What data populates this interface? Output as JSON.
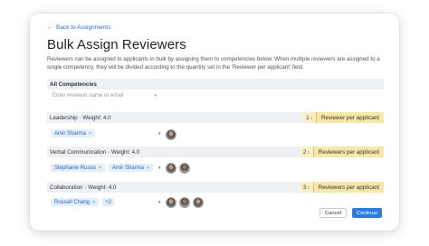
{
  "back_link": "Back to Assignments",
  "title": "Bulk Assign Reviewers",
  "description": "Reviewers can be assigned to applicants in bulk by assigning them to competencies below. When multiple reviewers are assigned to a single competency, they will be divided according to the quantity set in the 'Reviewer per applicant' field.",
  "all_competencies": {
    "label": "All Competencies",
    "placeholder": "Enter reviewer name or email"
  },
  "competencies": [
    {
      "name": "Leadership",
      "weight_text": "· Weight: 4.0",
      "quantity": "1",
      "qty_label": "Reviewer per applicant",
      "reviewers": [
        "Amir Sharma"
      ],
      "more": ""
    },
    {
      "name": "Verbal Communication",
      "weight_text": "· Weight: 4.0",
      "quantity": "2",
      "qty_label": "Reviewers per applicant",
      "reviewers": [
        "Stephanie Russo",
        "Amir Sharma"
      ],
      "more": ""
    },
    {
      "name": "Collaboration",
      "weight_text": "· Weight: 4.0",
      "quantity": "3",
      "qty_label": "Reviewers per applicant",
      "reviewers": [
        "Russell Chang"
      ],
      "more": "+2"
    }
  ],
  "buttons": {
    "cancel": "Cancel",
    "continue": "Continue"
  },
  "colors": {
    "accent": "#2f7be0",
    "chip_bg": "#e4effc",
    "qty_bg": "#f8e7a8"
  }
}
